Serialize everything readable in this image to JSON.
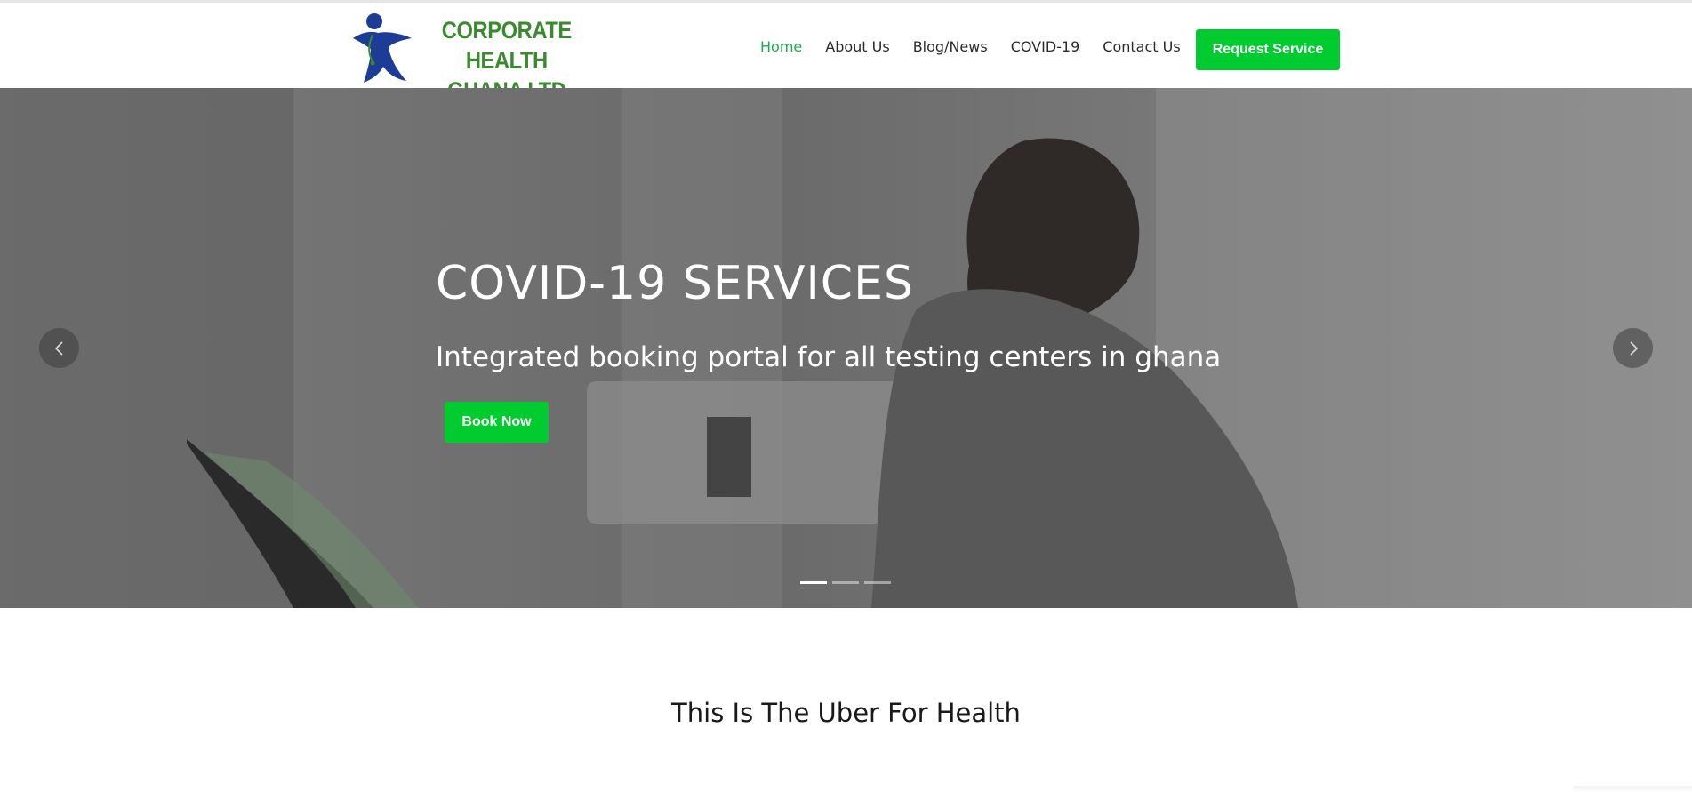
{
  "brand": {
    "logo_line1": "CORPORATE HEALTH",
    "logo_line2": "GHANA LTD",
    "logo_text_color": "#3a8a2e",
    "logo_figure_color": "#1c3c96"
  },
  "nav": {
    "items": [
      {
        "label": "Home",
        "active": true
      },
      {
        "label": "About Us"
      },
      {
        "label": "Blog/News"
      },
      {
        "label": "COVID-19"
      },
      {
        "label": "Contact Us"
      }
    ],
    "active_color": "#1eaa4b"
  },
  "header": {
    "cta_label": "Request Service"
  },
  "hero": {
    "title": "COVID-19 SERVICES",
    "subtitle": "Integrated booking portal for all testing centers in ghana",
    "cta_label": "Book Now",
    "prev_icon": "chevron-left-icon",
    "next_icon": "chevron-right-icon",
    "slide_count": 3,
    "active_slide": 1
  },
  "section": {
    "title": "This Is The Uber For Health"
  },
  "colors": {
    "accent": "#00cc2f",
    "text_dark": "#2b2b2b"
  }
}
